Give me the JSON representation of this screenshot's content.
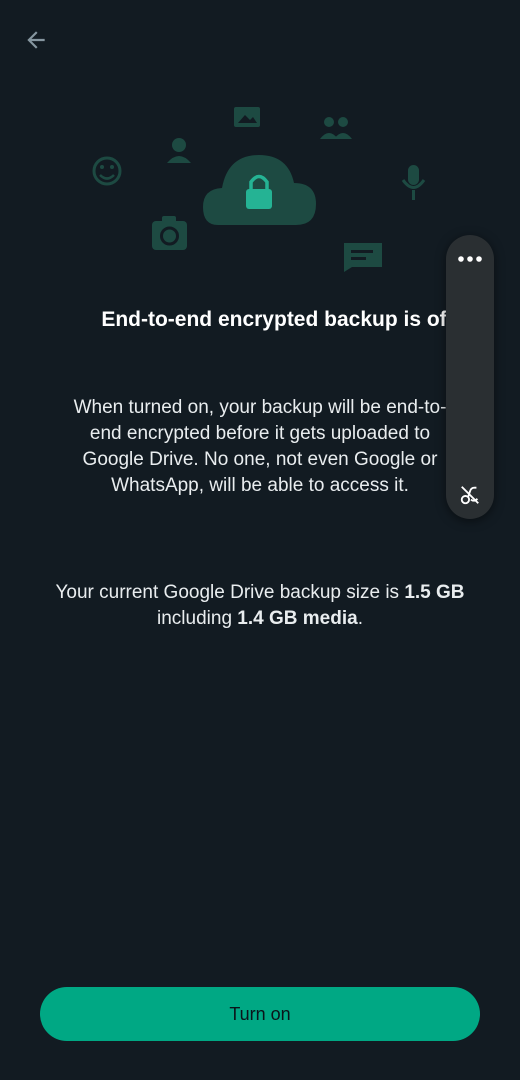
{
  "header": {
    "back_icon": "arrow-left-icon"
  },
  "illustration": {
    "icons": [
      "smiley-icon",
      "contact-icon",
      "image-icon",
      "group-icon",
      "cloud-lock-icon",
      "microphone-icon",
      "camera-icon",
      "message-icon"
    ],
    "accent_color": "#1d4a42",
    "lock_color": "#25b394"
  },
  "content": {
    "title": "End-to-end encrypted backup is of",
    "description": "When turned on, your backup will be end-to-end encrypted before it gets uploaded to Google Drive. No one, not even Google or WhatsApp, will be able to access it.",
    "size_prefix": "Your current Google Drive backup size is ",
    "backup_size": "1.5 GB",
    "size_middle": " including ",
    "media_size": "1.4 GB media",
    "size_suffix": "."
  },
  "overlay": {
    "more_icon": "more-horizontal-icon",
    "tool_icon": "link-off-icon"
  },
  "actions": {
    "turn_on_label": "Turn on",
    "button_color": "#00a884"
  }
}
